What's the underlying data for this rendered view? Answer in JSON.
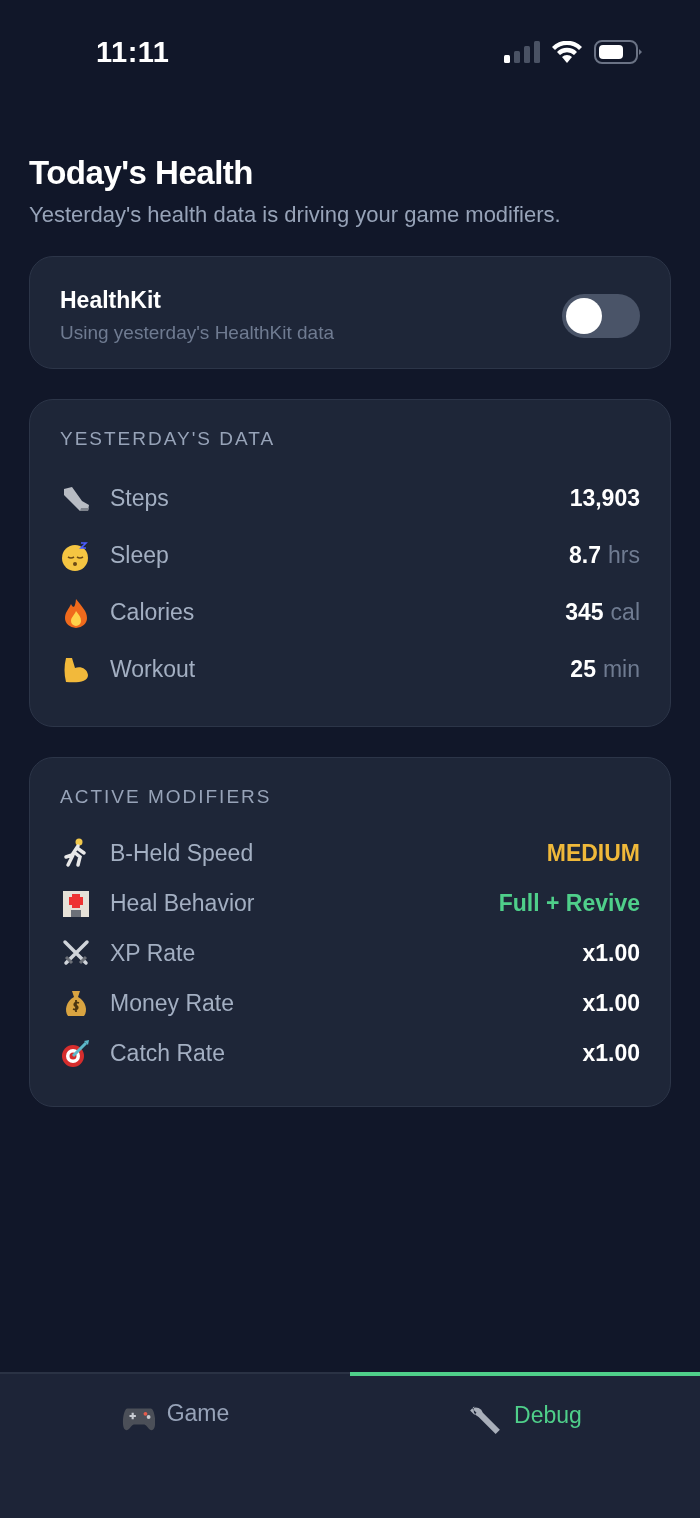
{
  "status_bar": {
    "time": "11:11"
  },
  "header": {
    "title": "Today's Health",
    "subtitle": "Yesterday's health data is driving your game modifiers."
  },
  "healthkit": {
    "title": "HealthKit",
    "subtitle": "Using yesterday's HealthKit data",
    "on": false
  },
  "yesterday": {
    "heading": "YESTERDAY'S DATA",
    "rows": [
      {
        "label": "Steps",
        "value": "13,903"
      },
      {
        "label": "Sleep",
        "value": "8.7",
        "unit": "hrs"
      },
      {
        "label": "Calories",
        "value": "345",
        "unit": "cal"
      },
      {
        "label": "Workout",
        "value": "25",
        "unit": "min"
      }
    ]
  },
  "modifiers": {
    "heading": "ACTIVE MODIFIERS",
    "rows": [
      {
        "label": "B-Held Speed",
        "value": "MEDIUM",
        "color": "#f0b93a"
      },
      {
        "label": "Heal Behavior",
        "value": "Full + Revive",
        "color": "#4fcf8a"
      },
      {
        "label": "XP Rate",
        "value": "x1.00",
        "color": "#ffffff"
      },
      {
        "label": "Money Rate",
        "value": "x1.00",
        "color": "#ffffff"
      },
      {
        "label": "Catch Rate",
        "value": "x1.00",
        "color": "#ffffff"
      }
    ]
  },
  "tabs": [
    {
      "label": "Game",
      "selected": false
    },
    {
      "label": "Debug",
      "selected": true
    }
  ]
}
